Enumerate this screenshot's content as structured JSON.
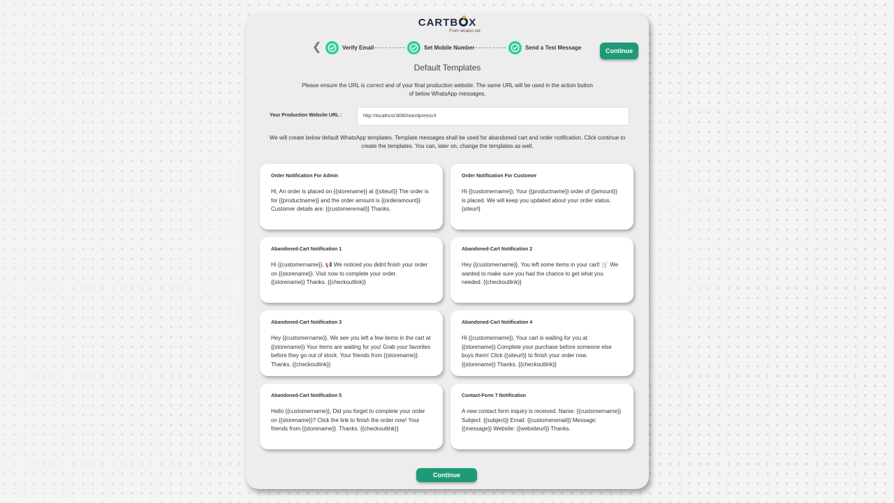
{
  "brand": {
    "name_pre": "CARTB",
    "name_post": "X",
    "tagline": "From whatso.net"
  },
  "stepper": {
    "steps": [
      {
        "label": "Verify Email"
      },
      {
        "label": "Set Mobile Number"
      },
      {
        "label": "Send a Test Message"
      }
    ]
  },
  "buttons": {
    "continue_top": "Continue",
    "continue_bottom": "Continue"
  },
  "heading": "Default Templates",
  "intro": "Please ensure the URL is correct and of your final production website. The same URL will be used in the action button of below WhatsApp messages.",
  "url": {
    "label": "Your Production Website URL :",
    "value": "http://localhost:8080/wordpressv3"
  },
  "description": "We will create below default WhatsApp templates. Template messages shall be used for abandoned cart and order notification. Click continue to create the templates. You can, later on, change the templates as well.",
  "templates": [
    {
      "title": "Order Notification For Admin",
      "body": "Hi, An order is placed on {{storename}} at {{siteurl}} The order is for {{productname}} and the order amount is {{orderamount}} Customer details are: {{customeremail}} Thanks."
    },
    {
      "title": "Order Notification For Customer",
      "body": "Hi {{customername}}, Your {{productname}} order of {{amount}} is placed. We will keep you updated about your order status. {siteurl}"
    },
    {
      "title": "Abandoned-Cart Notification 1",
      "body": "Hi {{customername}}, 📢 We noticed you didnt finish your order on {{storename}}. Visit now to complete your order. {{storename}} Thanks. {{checkoutlink}}"
    },
    {
      "title": "Abandoned-Cart Notification 2",
      "body": "Hey {{customername}}, You left some items in your cart! 🛒 We wanted to make sure you had the chance to get what you needed. {{checkoutlink}}"
    },
    {
      "title": "Abandoned-Cart Notification 3",
      "body": "Hey {{customername}}, We see you left a few items in the cart at {{storename}} Your items are waiting for you! Grab your favorites before they go out of stock. Your friends from {{storename}}. Thanks. {{checkoutlink}}"
    },
    {
      "title": "Abandoned-Cart Notification 4",
      "body": "Hi {{customername}}, Your cart is waiting for you at {{storename}} Complete your purchase before someone else buys them! Click {{siteurl}} to finish your order now. {{storename}} Thanks. {{checkoutlink}}"
    },
    {
      "title": "Abandoned-Cart Notification 5",
      "body": "Hello {{customername}}, Did you forget to complete your order on {{storename}}? Click the link to finish the order now! Your friends from {{storename}}. Thanks. {{checkoutlink}}"
    },
    {
      "title": "Contact-Form 7 Notification",
      "body": "A new contact form inquiry is received. Name: {{customername}} Subject: {{subject}} Email: {{customeremail}} Message: {{message}} Website: {{websiteurl}} Thanks."
    }
  ],
  "colors": {
    "accent": "#1f9a78",
    "check": "#2ecf98",
    "brand_dark": "#1f2a44",
    "brand_dot": "#f2a33a"
  },
  "icons": {
    "back": "chevron-left-icon",
    "step": "check-circle-icon"
  }
}
